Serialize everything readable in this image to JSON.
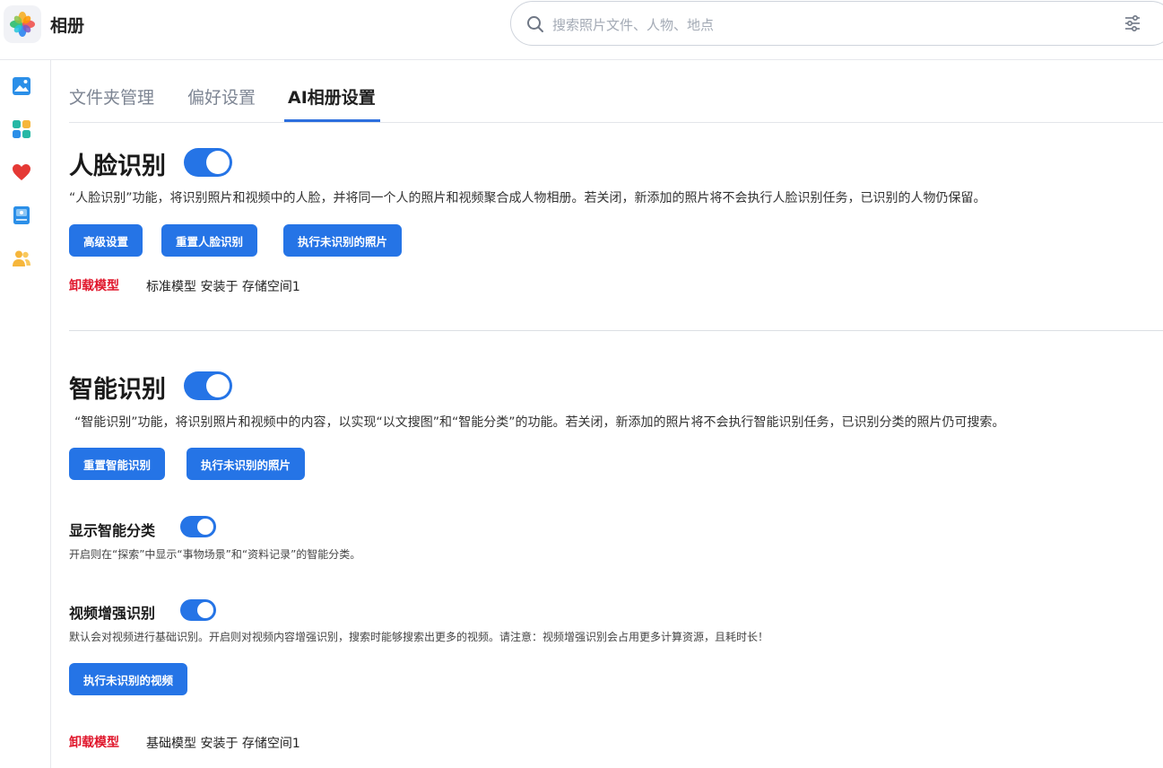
{
  "app": {
    "title": "相册"
  },
  "search": {
    "placeholder": "搜索照片文件、人物、地点"
  },
  "sidebar": {
    "items": [
      {
        "icon": "photos-icon"
      },
      {
        "icon": "albums-icon"
      },
      {
        "icon": "favorites-heart-icon"
      },
      {
        "icon": "storage-icon"
      },
      {
        "icon": "people-icon"
      }
    ]
  },
  "tabs": [
    {
      "label": "文件夹管理",
      "active": false
    },
    {
      "label": "偏好设置",
      "active": false
    },
    {
      "label": "AI相册设置",
      "active": true
    }
  ],
  "face": {
    "title": "人脸识别",
    "enabled": true,
    "description": "“人脸识别”功能，将识别照片和视频中的人脸，并将同一个人的照片和视频聚合成人物相册。若关闭，新添加的照片将不会执行人脸识别任务，已识别的人物仍保留。",
    "buttons": {
      "advanced": "高级设置",
      "reset": "重置人脸识别",
      "run": "执行未识别的照片"
    },
    "uninstall_label": "卸载模型",
    "model_info": "标准模型 安装于 存储空间1"
  },
  "smart": {
    "title": "智能识别",
    "enabled": true,
    "description": "“智能识别”功能，将识别照片和视频中的内容，以实现“以文搜图”和“智能分类”的功能。若关闭，新添加的照片将不会执行智能识别任务，已识别分类的照片仍可搜索。",
    "buttons": {
      "reset": "重置智能识别",
      "run": "执行未识别的照片"
    },
    "show_category": {
      "title": "显示智能分类",
      "enabled": true,
      "description": "开启则在“探索”中显示“事物场景”和“资料记录”的智能分类。"
    },
    "video_enhance": {
      "title": "视频增强识别",
      "enabled": true,
      "description": "默认会对视频进行基础识别。开启则对视频内容增强识别，搜索时能够搜索出更多的视频。请注意：视频增强识别会占用更多计算资源，且耗时长！",
      "run_label": "执行未识别的视频"
    },
    "uninstall_label": "卸载模型",
    "model_info": "基础模型 安装于 存储空间1"
  },
  "colors": {
    "accent": "#2574e6",
    "danger": "#e0162b"
  }
}
